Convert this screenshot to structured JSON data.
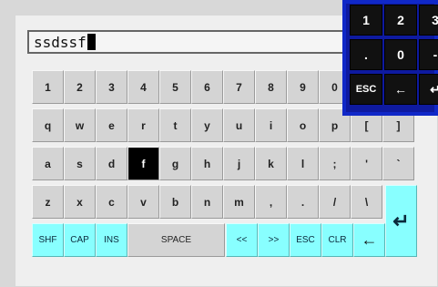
{
  "display": {
    "text": "ssdssf"
  },
  "keyboard": {
    "row_numbers": [
      "1",
      "2",
      "3",
      "4",
      "5",
      "6",
      "7",
      "8",
      "9",
      "0",
      "-",
      "="
    ],
    "row_q": [
      "q",
      "w",
      "e",
      "r",
      "t",
      "y",
      "u",
      "i",
      "o",
      "p",
      "[",
      "]"
    ],
    "row_a": [
      "a",
      "s",
      "d",
      "f",
      "g",
      "h",
      "j",
      "k",
      "l",
      ";",
      "'",
      "`"
    ],
    "row_z": [
      "z",
      "x",
      "c",
      "v",
      "b",
      "n",
      "m",
      ",",
      ".",
      "/",
      "\\"
    ],
    "active_key": "f",
    "bottom": {
      "shift": "SHF",
      "caps": "CAP",
      "insert": "INS",
      "space": "SPACE",
      "left": "<<",
      "right": ">>",
      "esc": "ESC",
      "clear": "CLR",
      "backspace": "←",
      "enter": "↵"
    }
  },
  "numpad": {
    "row1": [
      "1",
      "2",
      "3"
    ],
    "row2": [
      ".",
      "0",
      "-"
    ],
    "row3": [
      "ESC",
      "←",
      "↵"
    ]
  },
  "colors": {
    "panel": "#efefef",
    "key": "#d4d4d4",
    "special_key": "#88ffff",
    "numpad_border": "#1028c8",
    "active_key": "#000000"
  }
}
